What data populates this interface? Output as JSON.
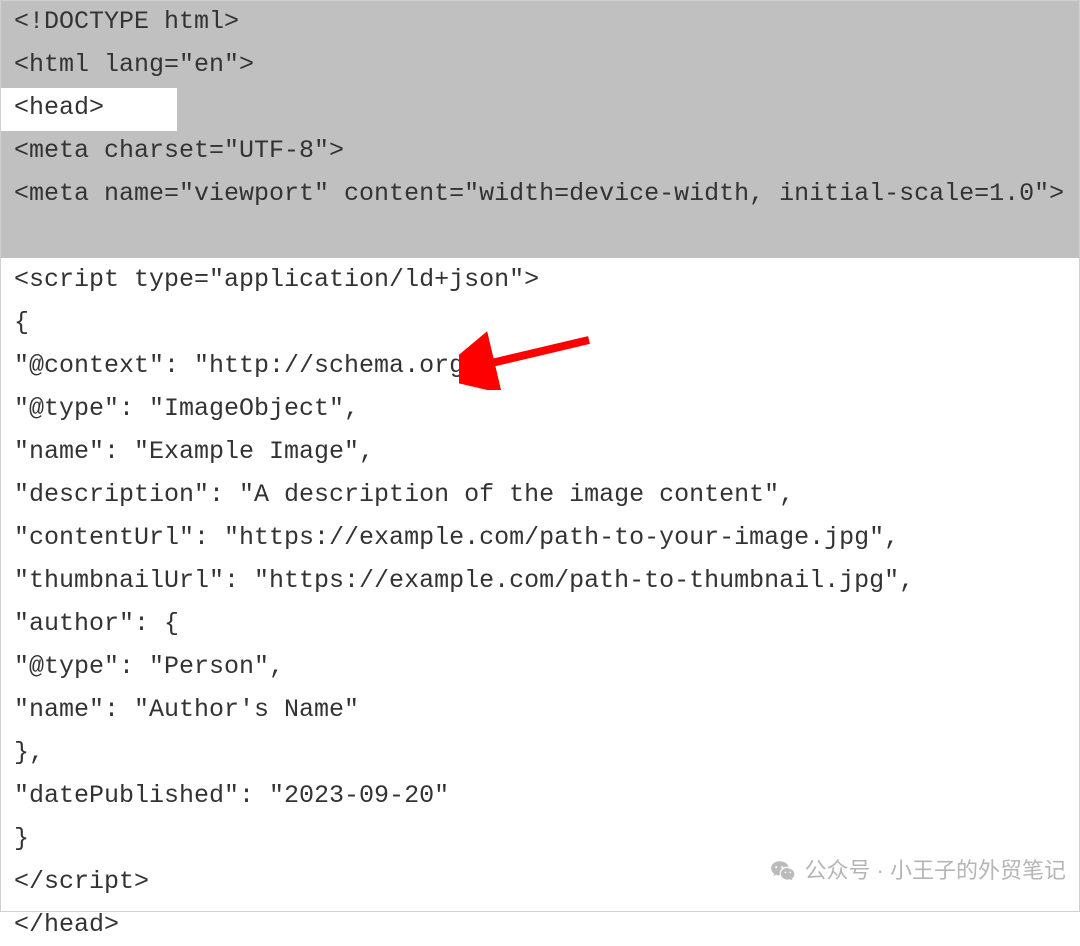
{
  "code": {
    "lines": [
      "<!DOCTYPE html>",
      "<html lang=\"en\">",
      "<head>",
      "<meta charset=\"UTF-8\">",
      "<meta name=\"viewport\" content=\"width=device-width, initial-scale=1.0\">",
      "",
      "<script type=\"application/ld+json\">",
      "{",
      "\"@context\": \"http://schema.org\",",
      "\"@type\": \"ImageObject\",",
      "\"name\": \"Example Image\",",
      "\"description\": \"A description of the image content\",",
      "\"contentUrl\": \"https://example.com/path-to-your-image.jpg\",",
      "\"thumbnailUrl\": \"https://example.com/path-to-thumbnail.jpg\",",
      "\"author\": {",
      "\"@type\": \"Person\",",
      "\"name\": \"Author's Name\"",
      "},",
      "\"datePublished\": \"2023-09-20\"",
      "}",
      "</script>",
      "</head>"
    ]
  },
  "watermark": {
    "text": "公众号 · 小王子的外贸笔记"
  },
  "annotation": {
    "arrow_color": "#ff0000",
    "arrow_target": "schema.org context line"
  },
  "highlight": {
    "selected_region_lines": [
      1,
      2,
      3,
      4,
      5,
      6
    ],
    "white_box_line": 3
  }
}
